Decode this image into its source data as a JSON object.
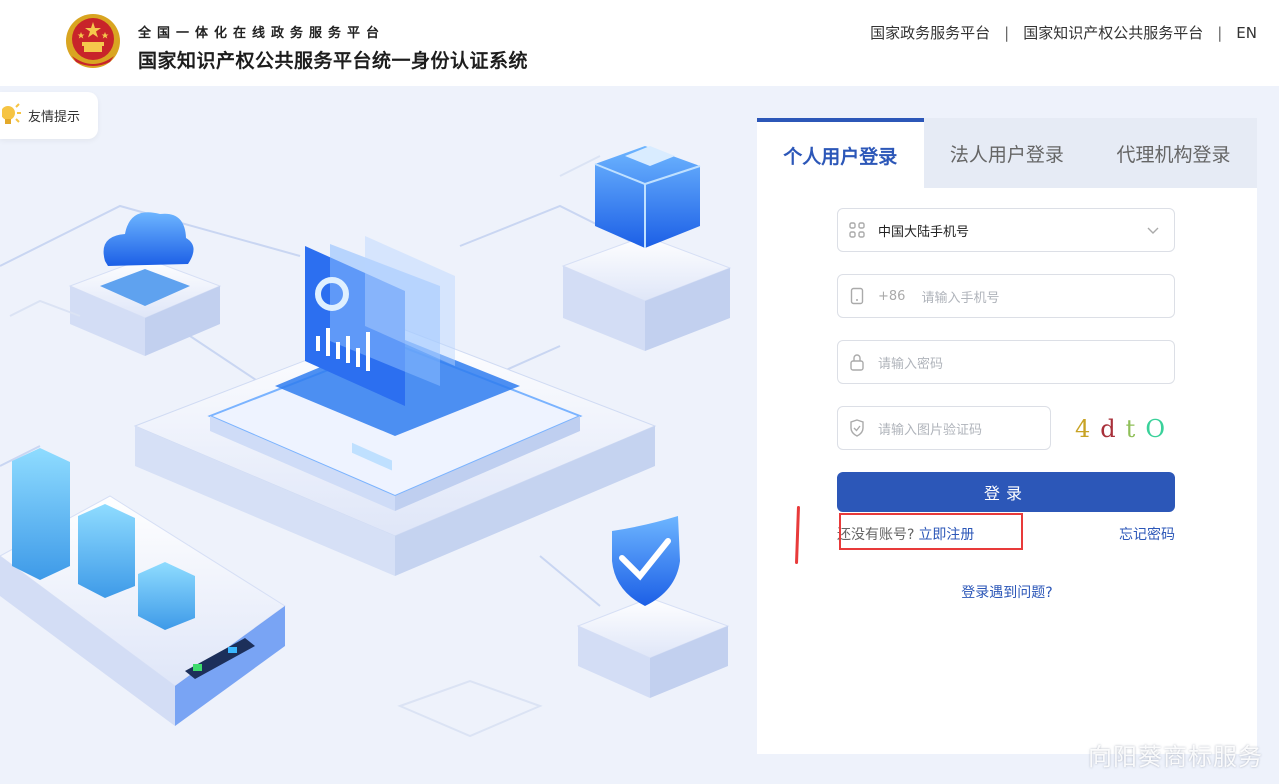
{
  "header": {
    "subtitle": "全国一体化在线政务服务平台",
    "title": "国家知识产权公共服务平台统一身份认证系统",
    "links": [
      "国家政务服务平台",
      "国家知识产权公共服务平台",
      "EN"
    ],
    "separator": "|"
  },
  "tip": {
    "label": "友情提示"
  },
  "login": {
    "tabs": [
      "个人用户登录",
      "法人用户登录",
      "代理机构登录"
    ],
    "active_tab": 0,
    "region_select": {
      "value": "中国大陆手机号"
    },
    "phone": {
      "prefix": "+86",
      "placeholder": "请输入手机号"
    },
    "password": {
      "placeholder": "请输入密码"
    },
    "captcha_input": {
      "placeholder": "请输入图片验证码"
    },
    "captcha_chars": [
      "4",
      "d",
      "t",
      "O"
    ],
    "submit_label": "登录",
    "no_account_text": "还没有账号?",
    "register_link": "立即注册",
    "forgot_link": "忘记密码",
    "help_link": "登录遇到问题?"
  },
  "watermark": "向阳葵商标服务",
  "colors": {
    "primary": "#2c57b8",
    "background": "#eef2fb",
    "annotation": "#e83a3a"
  }
}
